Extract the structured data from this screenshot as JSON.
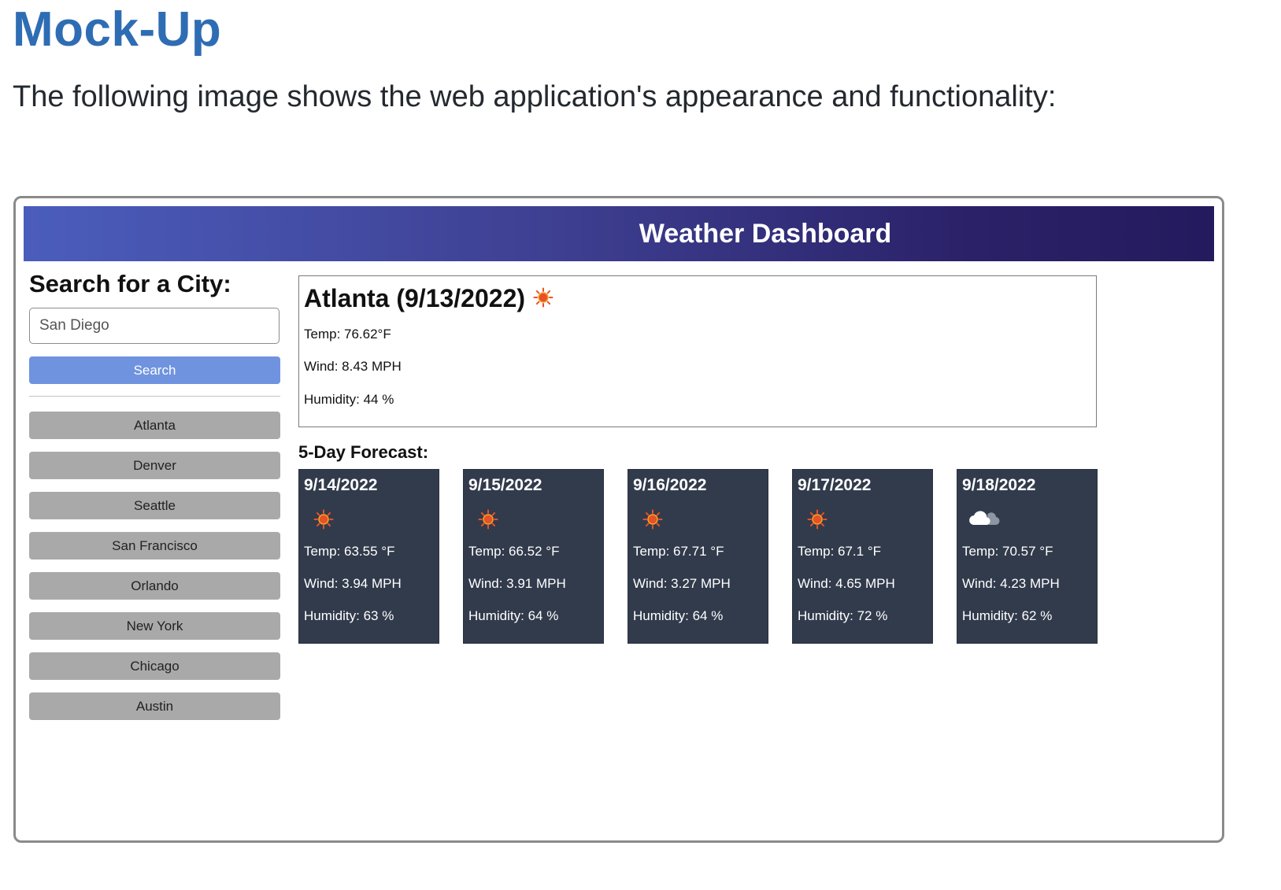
{
  "doc": {
    "heading": "Mock-Up",
    "intro": "The following image shows the web application's appearance and functionality:"
  },
  "app": {
    "title": "Weather Dashboard"
  },
  "search": {
    "title": "Search for a City:",
    "input_value": "San Diego",
    "button_label": "Search"
  },
  "history": [
    "Atlanta",
    "Denver",
    "Seattle",
    "San Francisco",
    "Orlando",
    "New York",
    "Chicago",
    "Austin"
  ],
  "current": {
    "title": "Atlanta (9/13/2022)",
    "icon": "sun-icon",
    "temp": "Temp: 76.62°F",
    "wind": "Wind: 8.43 MPH",
    "humidity": "Humidity: 44 %"
  },
  "forecast": {
    "title": "5-Day Forecast:",
    "days": [
      {
        "date": "9/14/2022",
        "icon": "sun-icon",
        "temp": "Temp: 63.55 °F",
        "wind": "Wind: 3.94 MPH",
        "humidity": "Humidity: 63 %"
      },
      {
        "date": "9/15/2022",
        "icon": "sun-icon",
        "temp": "Temp: 66.52 °F",
        "wind": "Wind: 3.91 MPH",
        "humidity": "Humidity: 64 %"
      },
      {
        "date": "9/16/2022",
        "icon": "sun-icon",
        "temp": "Temp: 67.71 °F",
        "wind": "Wind: 3.27 MPH",
        "humidity": "Humidity: 64 %"
      },
      {
        "date": "9/17/2022",
        "icon": "sun-icon",
        "temp": "Temp: 67.1 °F",
        "wind": "Wind: 4.65 MPH",
        "humidity": "Humidity: 72 %"
      },
      {
        "date": "9/18/2022",
        "icon": "cloud-icon",
        "temp": "Temp: 70.57 °F",
        "wind": "Wind: 4.23 MPH",
        "humidity": "Humidity: 62 %"
      }
    ]
  },
  "colors": {
    "heading": "#2e6db4",
    "header_gradient_start": "#4b5dbc",
    "header_gradient_end": "#241a5e",
    "search_button": "#6f93df",
    "history_button": "#a9a9a9",
    "forecast_card": "#323b4c",
    "sun": "#e8502a"
  }
}
